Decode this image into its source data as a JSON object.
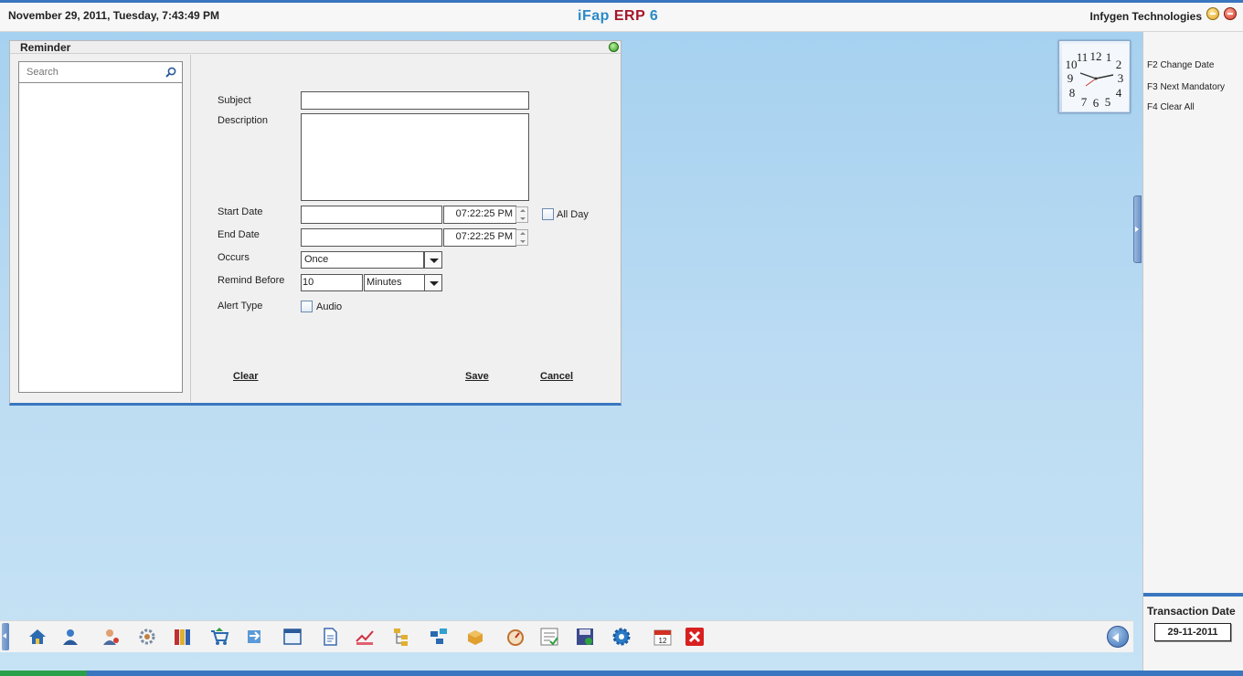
{
  "header": {
    "datetime": "November  29, 2011, Tuesday, 7:43:49 PM",
    "brand_part1": "iFap",
    "brand_part2": "ERP",
    "brand_part3": "6",
    "company": "Infygen Technologies",
    "brand_colors": {
      "blue": "#2a8ac8",
      "red": "#a5152a"
    }
  },
  "reminder": {
    "title": "Reminder",
    "search_placeholder": "Search",
    "labels": {
      "subject": "Subject",
      "description": "Description",
      "start_date": "Start Date",
      "end_date": "End Date",
      "occurs": "Occurs",
      "remind_before": "Remind Before",
      "alert_type": "Alert Type"
    },
    "values": {
      "subject": "",
      "description": "",
      "start_date": "",
      "start_time": "07:22:25 PM",
      "end_date": "",
      "end_time": "07:22:25 PM",
      "occurs": "Once",
      "remind_before_value": "10",
      "remind_before_unit": "Minutes"
    },
    "all_day_label": "All Day",
    "audio_label": "Audio",
    "buttons": {
      "clear": "Clear",
      "save": "Save",
      "cancel": "Cancel"
    }
  },
  "shortcuts": [
    "F2 Change Date",
    "F3 Next Mandatory",
    "F4 Clear All"
  ],
  "transaction": {
    "label": "Transaction Date",
    "date": "29-11-2011"
  },
  "clock": {
    "numerals": [
      "12",
      "1",
      "2",
      "3",
      "4",
      "5",
      "6",
      "7",
      "8",
      "9",
      "10",
      "11"
    ]
  },
  "taskbar_icons": [
    "home-icon",
    "user-icon",
    "customer-icon",
    "settings-wheel-icon",
    "books-icon",
    "cart-icon",
    "transfer-icon",
    "window-icon",
    "document-icon",
    "chart-icon",
    "folder-tree-icon",
    "network-icon",
    "package-icon",
    "dial-icon",
    "checklist-icon",
    "save-icon",
    "gear-icon",
    "calendar-icon",
    "exit-icon"
  ]
}
